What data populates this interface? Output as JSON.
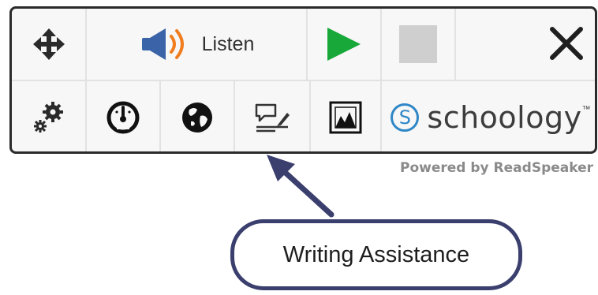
{
  "toolbar": {
    "move_icon": "move-arrows-icon",
    "listen": {
      "label": "Listen",
      "icon": "speaker-icon"
    },
    "play_icon": "play-icon",
    "stop_icon": "stop-icon",
    "close_icon": "close-icon",
    "settings_icon": "settings-gears-icon",
    "speedometer_icon": "speedometer-icon",
    "translate_icon": "globe-icon",
    "writing_icon": "writing-assistance-icon",
    "picture_icon": "picture-dictionary-icon",
    "brand": {
      "letter": "S",
      "name": "schoology",
      "mark": "™"
    }
  },
  "powered_by": "Powered by ReadSpeaker",
  "callout": {
    "text": "Writing Assistance"
  },
  "colors": {
    "play": "#18a83a",
    "stop": "#cfcfcf",
    "speaker_wave": "#f07d1f",
    "speaker_body": "#3a63a8",
    "brand": "#2f87c7",
    "callout_border": "#3a3f6e"
  }
}
